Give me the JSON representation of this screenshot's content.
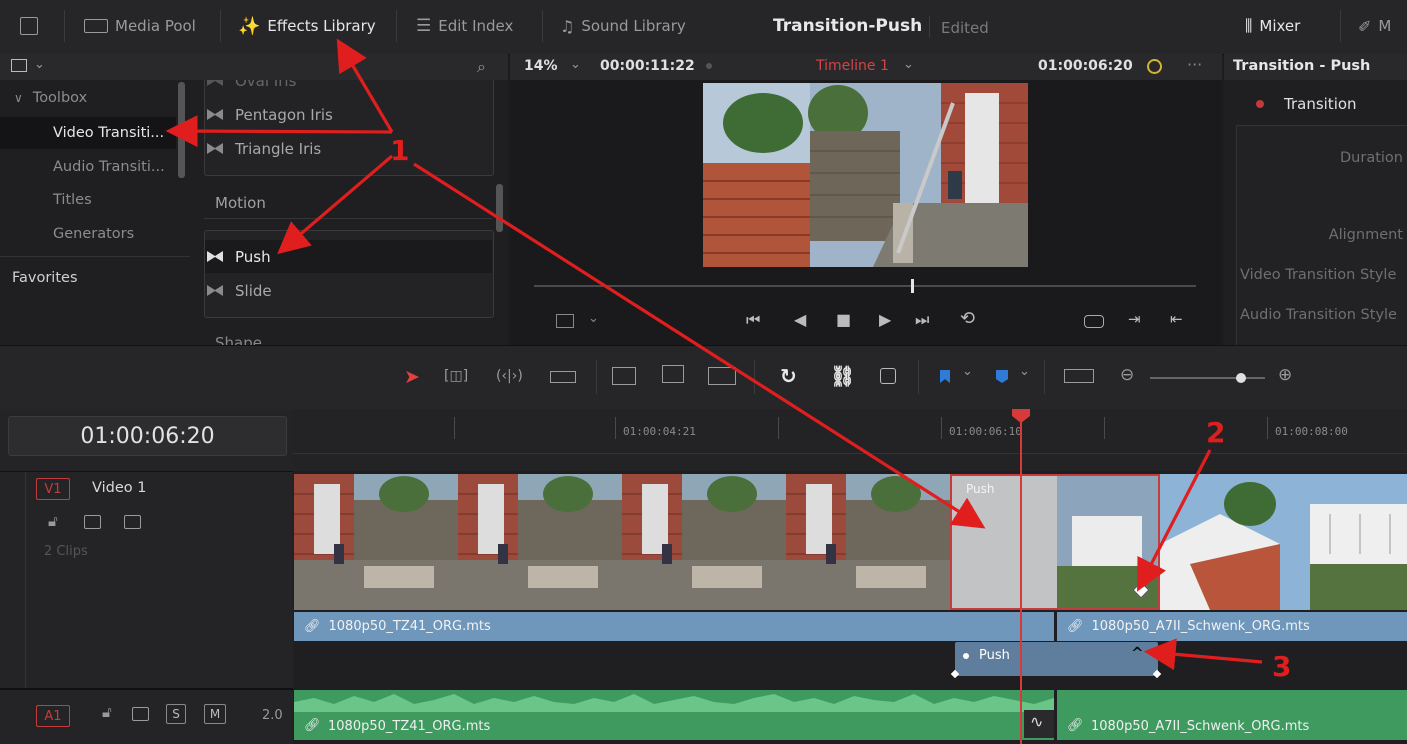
{
  "topbar": {
    "media_pool": "Media Pool",
    "effects_library": "Effects Library",
    "edit_index": "Edit Index",
    "sound_library": "Sound Library",
    "project_title": "Transition-Push",
    "edited": "Edited",
    "mixer": "Mixer",
    "metadata_partial": "M"
  },
  "toolbox": {
    "toolbox": "Toolbox",
    "video_transitions": "Video Transiti...",
    "audio_transitions": "Audio Transiti...",
    "titles": "Titles",
    "generators": "Generators",
    "favorites": "Favorites"
  },
  "effects": {
    "oval_iris": "Oval Iris",
    "pentagon_iris": "Pentagon Iris",
    "triangle_iris": "Triangle Iris",
    "motion_header": "Motion",
    "push": "Push",
    "slide": "Slide",
    "shape_header": "Shape"
  },
  "viewer": {
    "zoom": "14%",
    "duration": "00:00:11:22",
    "timeline_name": "Timeline 1",
    "timecode": "01:00:06:20",
    "playhead_fraction": 0.57
  },
  "inspector": {
    "title": "Transition - Push",
    "tab": "Transition",
    "duration": "Duration",
    "alignment": "Alignment",
    "video_style": "Video Transition Style",
    "audio_style": "Audio Transition Style"
  },
  "timeline": {
    "timecode": "01:00:06:20",
    "ruler_labels": [
      "01:00:04:21",
      "01:00:06:10",
      "01:00:08:00"
    ],
    "v1_badge": "V1",
    "v1_name": "Video 1",
    "v1_clips": "2 Clips",
    "a1_badge": "A1",
    "a1_level": "2.0",
    "s_btn": "S",
    "m_btn": "M",
    "clip1": "1080p50_TZ41_ORG.mts",
    "clip2": "1080p50_A7II_Schwenk_ORG.mts",
    "transition_label": "Push",
    "transition_curve": "Push"
  },
  "annotations": [
    "1",
    "1",
    "2",
    "3"
  ],
  "colors": {
    "accent_red": "#e01e1e",
    "video_clip": "#6f97bb",
    "audio_clip": "#3f9a5f",
    "playhead": "#d83a3a"
  }
}
